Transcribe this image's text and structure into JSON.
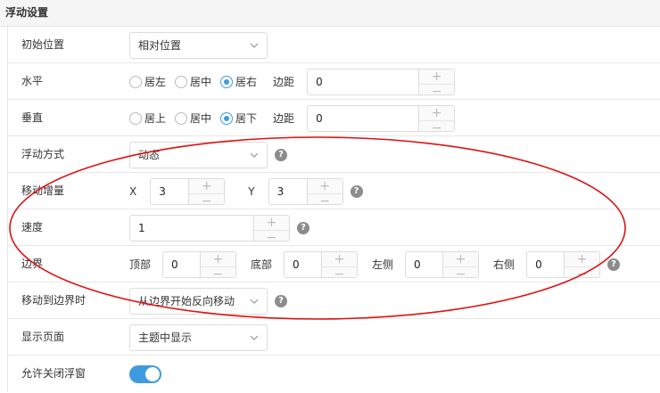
{
  "section_title": "浮动设置",
  "rows": {
    "initial_position": {
      "label": "初始位置",
      "value": "相对位置"
    },
    "horizontal": {
      "label": "水平",
      "options": [
        "居左",
        "居中",
        "居右"
      ],
      "selected_index": 2,
      "margin_label": "边距",
      "margin_value": "0"
    },
    "vertical": {
      "label": "垂直",
      "options": [
        "居上",
        "居中",
        "居下"
      ],
      "selected_index": 2,
      "margin_label": "边距",
      "margin_value": "0"
    },
    "float_mode": {
      "label": "浮动方式",
      "value": "动态"
    },
    "move_increment": {
      "label": "移动增量",
      "x_label": "X",
      "x_value": "3",
      "y_label": "Y",
      "y_value": "3"
    },
    "speed": {
      "label": "速度",
      "value": "1"
    },
    "border": {
      "label": "边界",
      "top_label": "顶部",
      "top_value": "0",
      "bottom_label": "底部",
      "bottom_value": "0",
      "left_label": "左侧",
      "left_value": "0",
      "right_label": "右侧",
      "right_value": "0"
    },
    "on_boundary": {
      "label": "移动到边界时",
      "value": "从边界开始反向移动"
    },
    "display_page": {
      "label": "显示页面",
      "value": "主题中显示"
    },
    "allow_close": {
      "label": "允许关闭浮窗",
      "enabled": true
    }
  },
  "stepper": {
    "plus": "+",
    "minus": "−"
  },
  "help_glyph": "?",
  "colors": {
    "accent": "#3f9be0",
    "annotation": "#dd1111"
  }
}
